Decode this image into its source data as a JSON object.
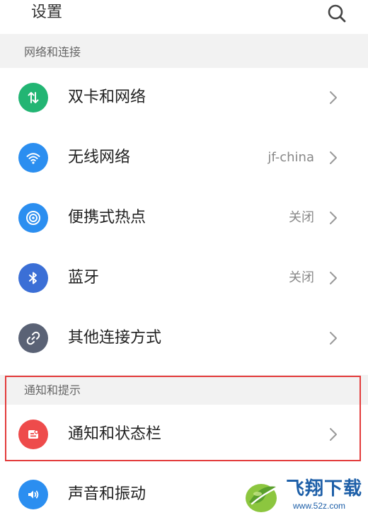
{
  "header": {
    "title": "设置"
  },
  "sections": [
    {
      "title": "网络和连接",
      "items": [
        {
          "label": "双卡和网络",
          "value": "",
          "icon": "sim-data-icon",
          "color": "#22b573"
        },
        {
          "label": "无线网络",
          "value": "jf-china",
          "icon": "wifi-icon",
          "color": "#2b8ef0"
        },
        {
          "label": "便携式热点",
          "value": "关闭",
          "icon": "hotspot-icon",
          "color": "#2b8ef0"
        },
        {
          "label": "蓝牙",
          "value": "关闭",
          "icon": "bluetooth-icon",
          "color": "#3b6fd6"
        },
        {
          "label": "其他连接方式",
          "value": "",
          "icon": "link-icon",
          "color": "#5a6275"
        }
      ]
    },
    {
      "title": "通知和提示",
      "items": [
        {
          "label": "通知和状态栏",
          "value": "",
          "icon": "notification-icon",
          "color": "#ee4b4b"
        },
        {
          "label": "声音和振动",
          "value": "",
          "icon": "sound-icon",
          "color": "#2b8ef0"
        }
      ]
    }
  ],
  "highlight_color": "#e33b3b",
  "watermark": {
    "brand": "飞翔下载",
    "url": "www.52z.com"
  }
}
